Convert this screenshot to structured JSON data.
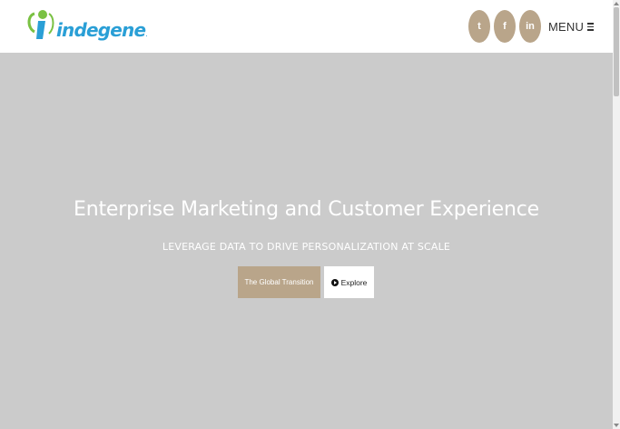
{
  "header": {
    "logo_text": "indegene",
    "logo_mark": ".",
    "social": [
      {
        "icon": "twitter-icon",
        "glyph": "t"
      },
      {
        "icon": "facebook-icon",
        "glyph": "f"
      },
      {
        "icon": "linkedin-icon",
        "glyph": "in"
      }
    ],
    "menu_label": "MENU"
  },
  "hero": {
    "title": "Enterprise Marketing and Customer Experience",
    "subtitle": "LEVERAGE DATA TO DRIVE PERSONALIZATION AT SCALE",
    "primary_button": "The Global Transition",
    "explore_button": "Explore"
  },
  "colors": {
    "accent": "#b9a58a",
    "hero_bg": "#cbcbcb",
    "logo_blue": "#2a9fd6",
    "logo_green": "#7ac143"
  }
}
